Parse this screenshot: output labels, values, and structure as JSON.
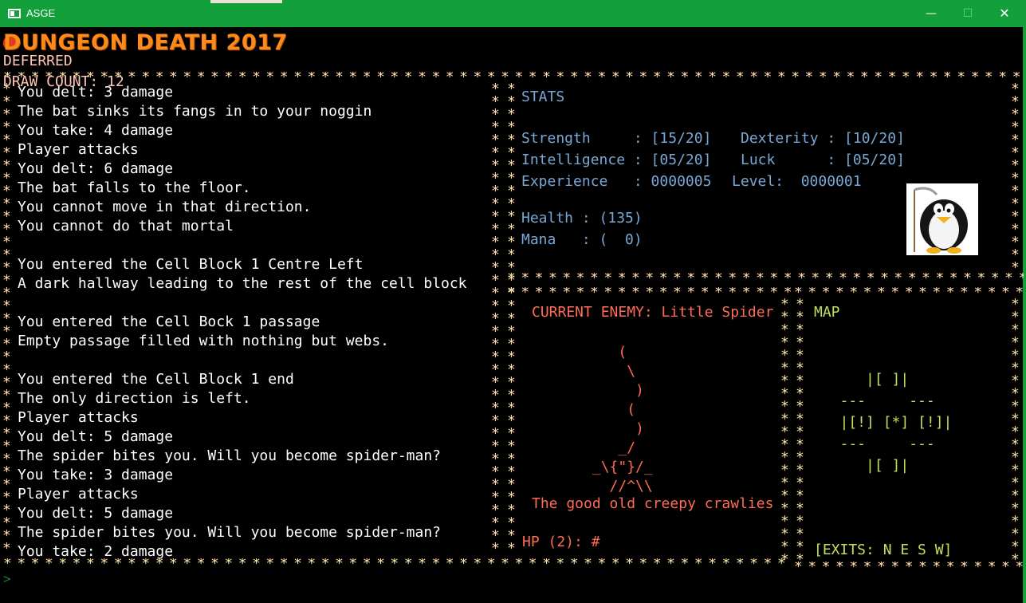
{
  "window": {
    "title": "ASGE",
    "minimize": "—",
    "maximize": "☐",
    "close": "✕"
  },
  "header": {
    "game_title": "DUNGEON DEATH 2017",
    "render_mode": "DEFERRED",
    "draw_count": "DRAW COUNT: 12"
  },
  "log": {
    "lines": [
      "You delt: 3 damage",
      "The bat sinks its fangs in to your noggin",
      "You take: 4 damage",
      "Player attacks",
      "You delt: 6 damage",
      "The bat falls to the floor.",
      "You cannot move in that direction.",
      "You cannot do that mortal",
      "",
      "You entered the Cell Block 1 Centre Left",
      "A dark hallway leading to the rest of the cell block",
      "",
      "You entered the Cell Bock 1 passage",
      "Empty passage filled with nothing but webs.",
      "",
      "You entered the Cell Block 1 end",
      "The only direction is left.",
      "Player attacks",
      "You delt: 5 damage",
      "The spider bites you. Will you become spider-man?",
      "You take: 3 damage",
      "Player attacks",
      "You delt: 5 damage",
      "The spider bites you. Will you become spider-man?",
      "You take: 2 damage"
    ]
  },
  "stats": {
    "heading": "STATS",
    "strength": "Strength     : [15/20]",
    "dexterity": "Dexterity : [10/20]",
    "intelligence": "Intelligence : [05/20]",
    "luck": "Luck      : [05/20]",
    "experience": "Experience   : 0000005",
    "level": "Level:  0000001",
    "health": "Health : (135)",
    "mana": "Mana   : (  0)"
  },
  "enemy": {
    "title": "CURRENT ENEMY: Little Spider",
    "art": "          (\n           \\\n            )\n           (\n            )\n          _/\n       _\\{\"}/_\n         //^\\\\",
    "description": "The good old creepy crawlies",
    "hp": "HP (2): #"
  },
  "map": {
    "title": "MAP",
    "art": "      |[ ]|\n   ---     ---\n   |[!] [*] [!]|\n   ---     ---\n      |[ ]|",
    "exits": "[EXITS: N E S W]"
  },
  "prompt": ">",
  "colors": {
    "titlebar": "#13a03b",
    "title_orange": "#ff8a1c",
    "stars": "#ffe0a8",
    "stats_blue": "#79a8d6",
    "enemy_red": "#ff6b54",
    "map_green": "#bfe05a"
  },
  "icons": {
    "app": "window-icon",
    "avatar": "penguin-reaper-icon"
  }
}
